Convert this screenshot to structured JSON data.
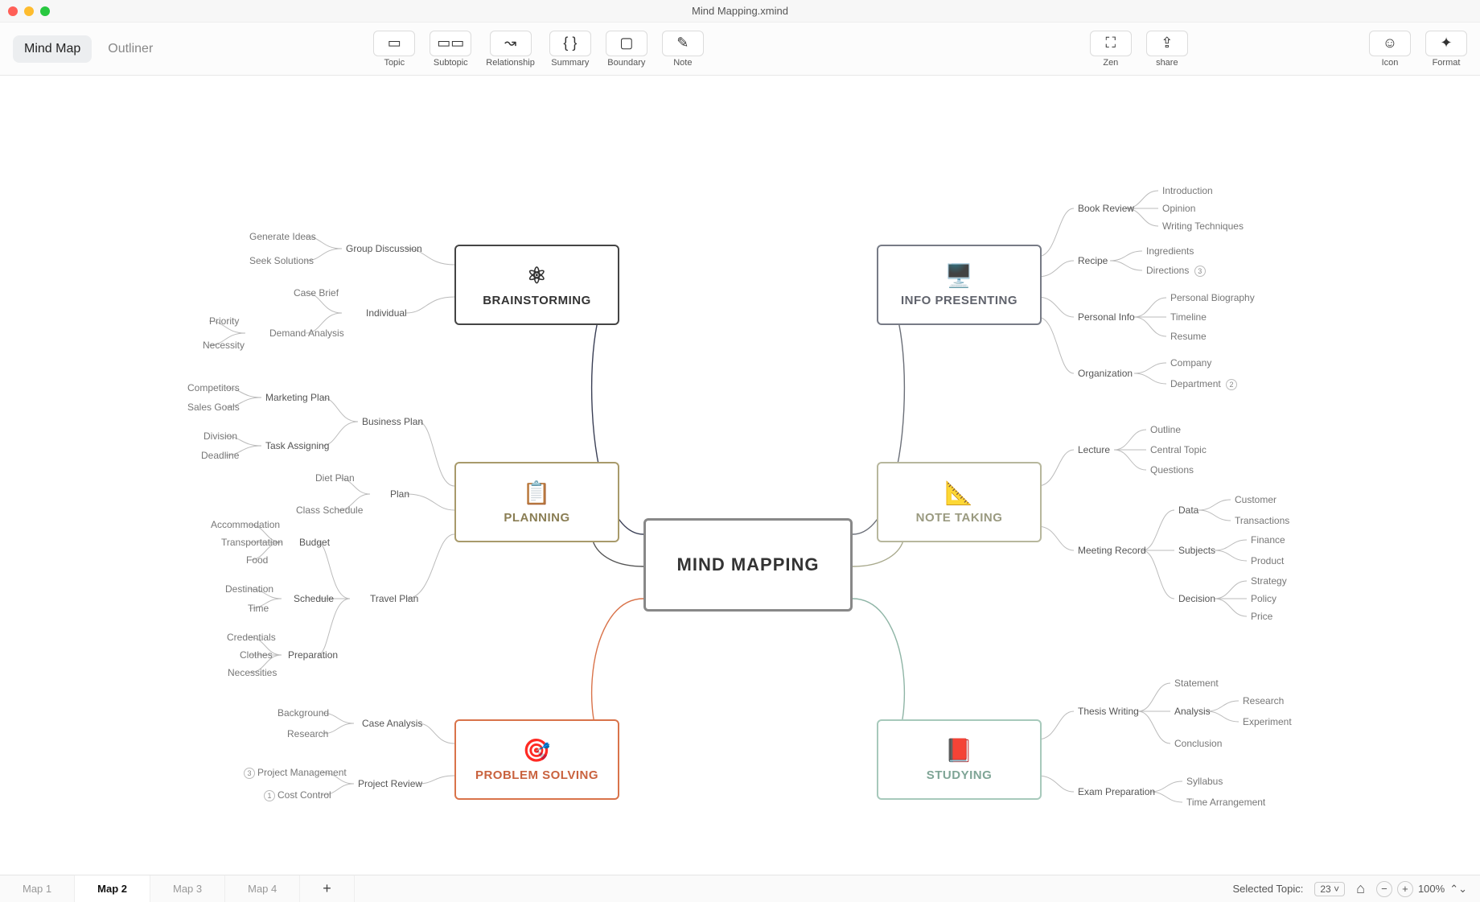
{
  "window": {
    "title": "Mind Mapping.xmind"
  },
  "viewTabs": {
    "mindmap": "Mind Map",
    "outliner": "Outliner"
  },
  "tools": {
    "topic": "Topic",
    "subtopic": "Subtopic",
    "relationship": "Relationship",
    "summary": "Summary",
    "boundary": "Boundary",
    "note": "Note",
    "zen": "Zen",
    "share": "share",
    "icon": "Icon",
    "format": "Format"
  },
  "center": {
    "title": "MIND MAPPING"
  },
  "branches": {
    "brainstorming": {
      "title": "BRAINSTORMING",
      "groupDiscussion": {
        "label": "Group Discussion",
        "leaves": [
          "Generate Ideas",
          "Seek Solutions"
        ]
      },
      "individual": {
        "label": "Individual",
        "caseBrief": "Case Brief",
        "demandAnalysis": "Demand Analysis",
        "priority": "Priority",
        "necessity": "Necessity"
      }
    },
    "planning": {
      "title": "PLANNING",
      "businessPlan": {
        "label": "Business Plan",
        "marketingPlan": {
          "label": "Marketing Plan",
          "leaves": [
            "Competitors",
            "Sales Goals"
          ]
        },
        "taskAssigning": {
          "label": "Task Assigning",
          "leaves": [
            "Division",
            "Deadline"
          ]
        }
      },
      "plan": {
        "label": "Plan",
        "leaves": [
          "Diet Plan",
          "Class Schedule"
        ]
      },
      "travelPlan": {
        "label": "Travel Plan",
        "budget": {
          "label": "Budget",
          "leaves": [
            "Accommodation",
            "Transportation",
            "Food"
          ]
        },
        "schedule": {
          "label": "Schedule",
          "leaves": [
            "Destination",
            "Time"
          ]
        },
        "preparation": {
          "label": "Preparation",
          "leaves": [
            "Credentials",
            "Clothes",
            "Necessities"
          ]
        }
      }
    },
    "problemSolving": {
      "title": "PROBLEM SOLVING",
      "caseAnalysis": {
        "label": "Case Analysis",
        "leaves": [
          "Background",
          "Research"
        ]
      },
      "projectReview": {
        "label": "Project Review",
        "pm": "Project Management",
        "pmBadge": "3",
        "cc": "Cost Control",
        "ccBadge": "1"
      }
    },
    "infoPresenting": {
      "title": "INFO PRESENTING",
      "bookReview": {
        "label": "Book Review",
        "leaves": [
          "Introduction",
          "Opinion",
          "Writing Techniques"
        ]
      },
      "recipe": {
        "label": "Recipe",
        "ingredients": "Ingredients",
        "directions": "Directions",
        "directionsBadge": "3"
      },
      "personalInfo": {
        "label": "Personal Info",
        "leaves": [
          "Personal Biography",
          "Timeline",
          "Resume"
        ]
      },
      "organization": {
        "label": "Organization",
        "company": "Company",
        "department": "Department",
        "departmentBadge": "2"
      }
    },
    "noteTaking": {
      "title": "NOTE TAKING",
      "lecture": {
        "label": "Lecture",
        "leaves": [
          "Outline",
          "Central Topic",
          "Questions"
        ]
      },
      "meetingRecord": {
        "label": "Meeting Record",
        "data": {
          "label": "Data",
          "leaves": [
            "Customer",
            "Transactions"
          ]
        },
        "subjects": {
          "label": "Subjects",
          "leaves": [
            "Finance",
            "Product"
          ]
        },
        "decision": {
          "label": "Decision",
          "leaves": [
            "Strategy",
            "Policy",
            "Price"
          ]
        }
      }
    },
    "studying": {
      "title": "STUDYING",
      "thesisWriting": {
        "label": "Thesis Writing",
        "statement": "Statement",
        "analysis": {
          "label": "Analysis",
          "leaves": [
            "Research",
            "Experiment"
          ]
        },
        "conclusion": "Conclusion"
      },
      "examPreparation": {
        "label": "Exam Preparation",
        "leaves": [
          "Syllabus",
          "Time Arrangement"
        ]
      }
    }
  },
  "sheets": {
    "map1": "Map 1",
    "map2": "Map 2",
    "map3": "Map 3",
    "map4": "Map 4"
  },
  "status": {
    "selectedLabel": "Selected Topic:",
    "selectedCount": "23",
    "zoom": "100%"
  }
}
